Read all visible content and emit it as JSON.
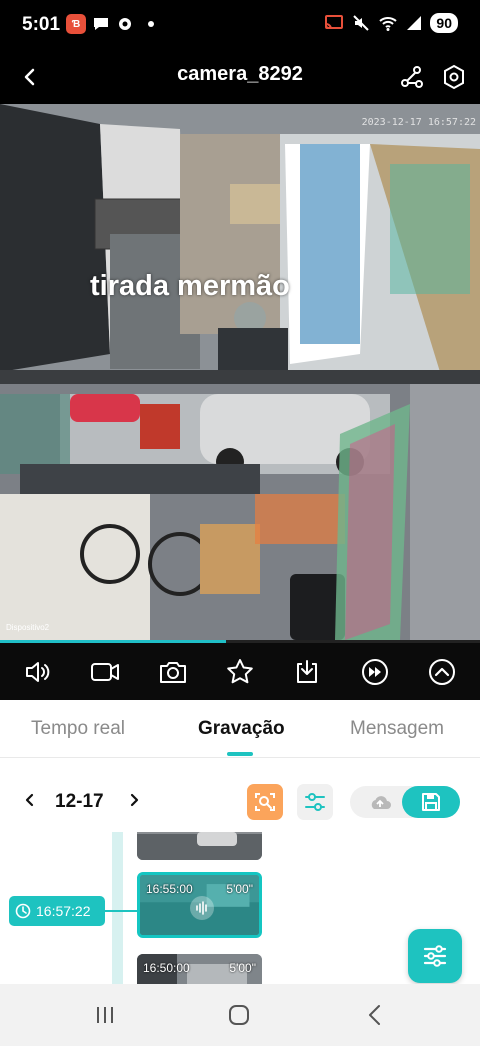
{
  "status_bar": {
    "time": "5:01",
    "app_badge": "Ɓ",
    "battery": "90",
    "icons": [
      "shopee-icon",
      "chat-icon",
      "gear-icon",
      "cast-icon",
      "mute-icon",
      "wifi-icon",
      "signal-icon"
    ]
  },
  "header": {
    "title": "camera_8292",
    "icons": [
      "back-arrow-icon",
      "share-icon",
      "settings-icon"
    ]
  },
  "video": {
    "overlay_text": "tirada mermão",
    "timestamp": "2023-12-17 16:57:22",
    "device_label": "Dispositivo2",
    "progress": 0.47
  },
  "controls": {
    "icons": [
      "volume-icon",
      "record-video-icon",
      "snapshot-icon",
      "favorite-icon",
      "download-icon",
      "fast-forward-icon",
      "collapse-up-icon"
    ]
  },
  "tabs": [
    {
      "label": "Tempo real",
      "active": false
    },
    {
      "label": "Gravação",
      "active": true
    },
    {
      "label": "Mensagem",
      "active": false
    }
  ],
  "date_bar": {
    "date": "12-17",
    "icons": [
      "chevron-left-icon",
      "chevron-right-icon",
      "search-recording-icon",
      "filter-sliders-icon",
      "cloud-icon",
      "sd-card-icon"
    ]
  },
  "timeline": {
    "current_time": "16:57:22",
    "clips": [
      {
        "time": "",
        "duration": "",
        "selected": false
      },
      {
        "time": "16:55:00",
        "duration": "5'00\"",
        "selected": true
      },
      {
        "time": "16:50:00",
        "duration": "5'00\"",
        "selected": false
      }
    ]
  },
  "colors": {
    "accent": "#1ec3c0",
    "search_button": "#fba45b",
    "header_bg": "#000000"
  }
}
